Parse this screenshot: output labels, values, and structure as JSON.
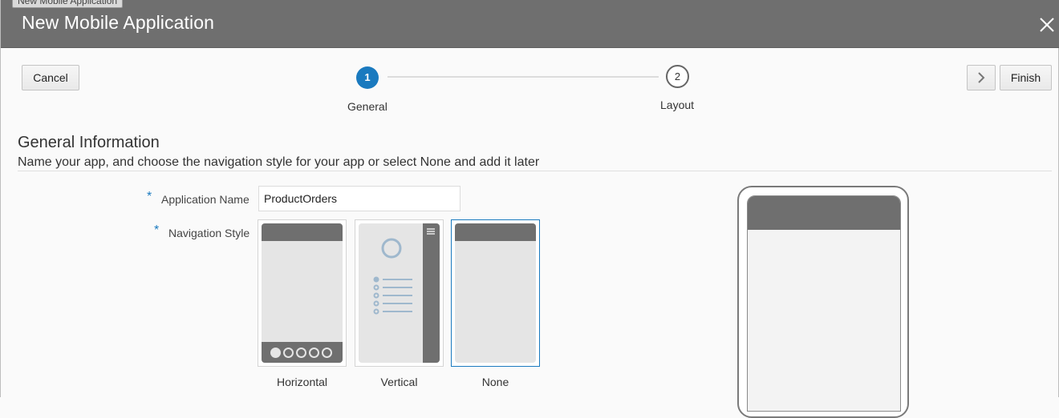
{
  "window": {
    "tab_label": "New Mobile Application",
    "title": "New Mobile Application"
  },
  "toolbar": {
    "cancel_label": "Cancel",
    "finish_label": "Finish",
    "next_icon": "chevron-right-icon"
  },
  "train": {
    "steps": [
      {
        "number": "1",
        "label": "General",
        "state": "current"
      },
      {
        "number": "2",
        "label": "Layout",
        "state": "upcoming"
      }
    ]
  },
  "section": {
    "title": "General Information",
    "description": "Name your app, and choose the navigation style for your app or select None and add it later"
  },
  "form": {
    "required_mark": "*",
    "app_name_label": "Application Name",
    "app_name_value": "ProductOrders",
    "nav_style_label": "Navigation Style",
    "nav_options": [
      {
        "label": "Horizontal",
        "selected": false
      },
      {
        "label": "Vertical",
        "selected": false
      },
      {
        "label": "None",
        "selected": true
      }
    ]
  },
  "colors": {
    "titlebar": "#6f6f6f",
    "accent": "#1a7abf",
    "background": "#fafafa"
  }
}
